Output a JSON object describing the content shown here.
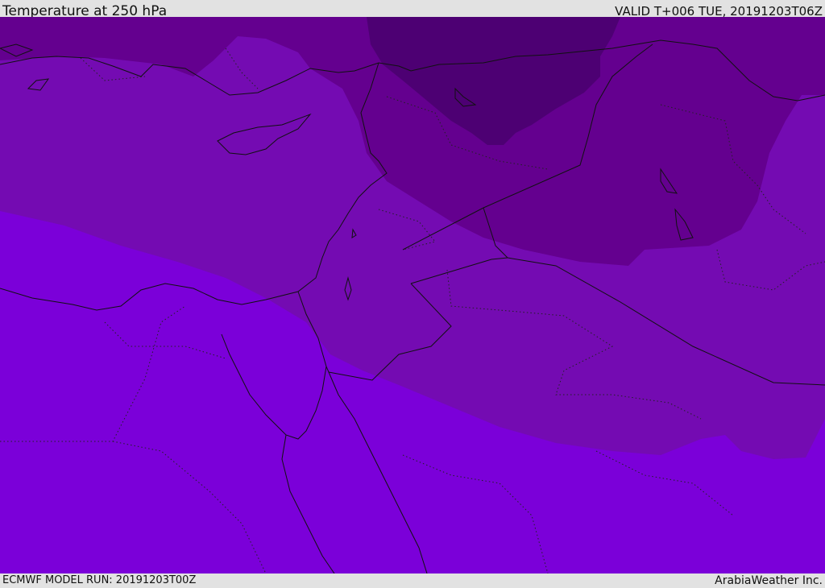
{
  "header": {
    "title": "Temperature at 250 hPa",
    "valid": "VALID T+006 TUE, 20191203T06Z"
  },
  "footer": {
    "model_run": "ECMWF MODEL RUN: 20191203T00Z",
    "credit": "ArabiaWeather Inc."
  },
  "map": {
    "parameter": "Temperature",
    "level": "250 hPa",
    "colors": {
      "coldest": "#4d0073",
      "cold": "#64008f",
      "mid": "#740bb2",
      "warm": "#7b00d9",
      "border": "#111111",
      "land": "#2a004a"
    }
  }
}
